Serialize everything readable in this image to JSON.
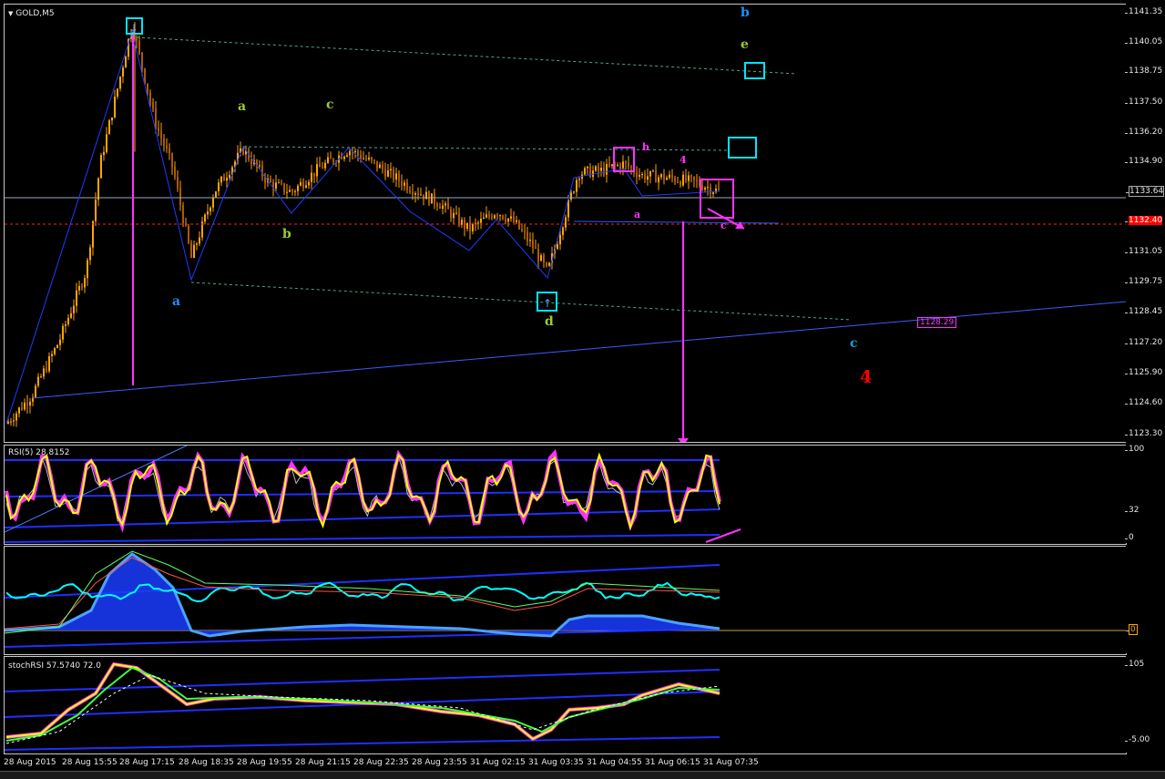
{
  "chart": {
    "symbol_label": "GOLD,M5",
    "price_ticks": [
      "1141.35",
      "1140.05",
      "1138.75",
      "1137.50",
      "1136.20",
      "1134.90",
      "1133.64",
      "1132.35",
      "1131.05",
      "1129.75",
      "1128.45",
      "1127.20",
      "1125.90",
      "1124.60",
      "1123.30"
    ],
    "current_price": "1133.64",
    "red_price_tag": "1132.40",
    "trend_level_tag": "1128.29",
    "wave_labels": {
      "a_blue": "a",
      "a_green": "a",
      "b_green": "b",
      "c_green": "c",
      "d_green": "d",
      "e_green": "e",
      "b_blue": "b",
      "c_blue": "c",
      "b_magenta": "b",
      "four_magenta": "4",
      "a_magenta": "a",
      "c_magenta": "c",
      "four_red": "4"
    },
    "colors": {
      "bull": "#ffa500",
      "bear": "#ffa500",
      "cyan": "#00e5ff",
      "magenta": "#ff33ff",
      "green_label": "#9acd32",
      "blue_label": "#1e90ff",
      "red": "#ff0000",
      "trend_blue": "#1f3bff"
    }
  },
  "rsi_panel": {
    "label": "RSI(5) 28.8152",
    "ticks": [
      "100",
      "32",
      "0"
    ]
  },
  "osc_panel": {
    "ticks": [
      "0"
    ]
  },
  "stoch_panel": {
    "label": "stochRSI 57.5740 72.0",
    "ticks": [
      "105",
      "-5.00"
    ]
  },
  "time_axis": [
    "28 Aug 2015",
    "28 Aug 15:55",
    "28 Aug 17:15",
    "28 Aug 18:35",
    "28 Aug 19:55",
    "28 Aug 21:15",
    "28 Aug 22:35",
    "28 Aug 23:55",
    "31 Aug 02:15",
    "31 Aug 03:35",
    "31 Aug 04:55",
    "31 Aug 06:15",
    "31 Aug 07:35"
  ]
}
